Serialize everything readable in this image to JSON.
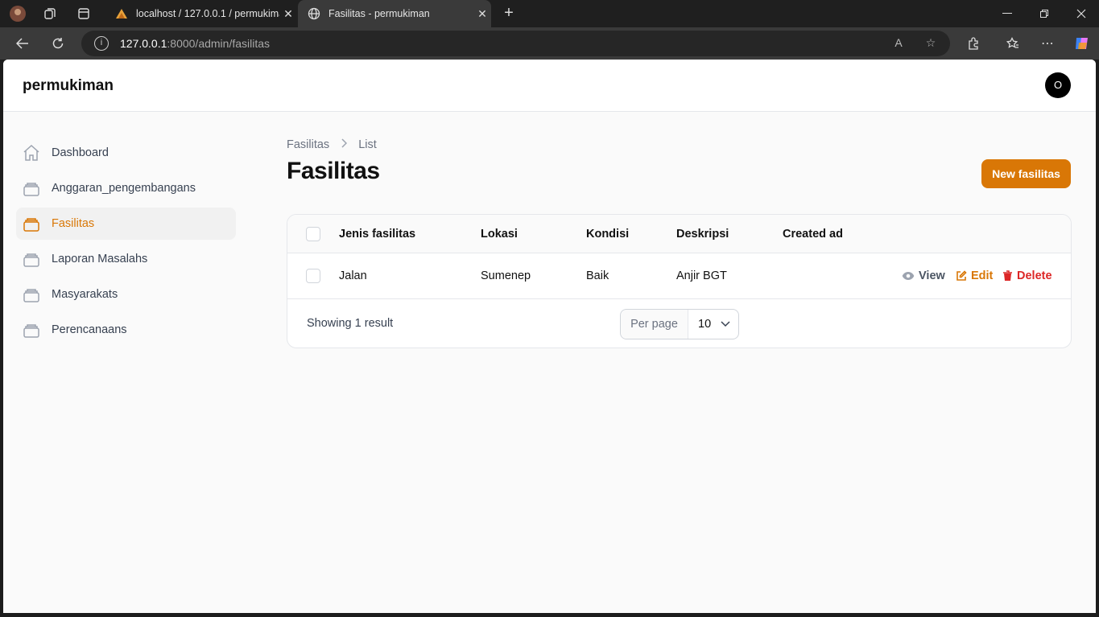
{
  "browser": {
    "tabs": [
      {
        "title": "localhost / 127.0.0.1 / permukiman",
        "active": false
      },
      {
        "title": "Fasilitas - permukiman",
        "active": true
      }
    ],
    "url_host": "127.0.0.1",
    "url_path": ":8000/admin/fasilitas"
  },
  "app": {
    "brand": "permukiman",
    "user_initial": "O",
    "accent_color": "#d97706"
  },
  "sidebar": {
    "items": [
      {
        "label": "Dashboard",
        "icon": "home-icon",
        "active": false
      },
      {
        "label": "Anggaran_pengembangans",
        "icon": "collection-icon",
        "active": false
      },
      {
        "label": "Fasilitas",
        "icon": "collection-icon",
        "active": true
      },
      {
        "label": "Laporan Masalahs",
        "icon": "collection-icon",
        "active": false
      },
      {
        "label": "Masyarakats",
        "icon": "collection-icon",
        "active": false
      },
      {
        "label": "Perencanaans",
        "icon": "collection-icon",
        "active": false
      }
    ]
  },
  "main": {
    "breadcrumb": [
      "Fasilitas",
      "List"
    ],
    "title": "Fasilitas",
    "new_button": "New fasilitas",
    "table": {
      "columns": [
        "Jenis fasilitas",
        "Lokasi",
        "Kondisi",
        "Deskripsi",
        "Created ad"
      ],
      "rows": [
        {
          "cells": [
            "Jalan",
            "Sumenep",
            "Baik",
            "Anjir BGT",
            ""
          ]
        }
      ],
      "actions": {
        "view": "View",
        "edit": "Edit",
        "delete": "Delete"
      }
    },
    "footer": {
      "showing": "Showing 1 result",
      "per_page_label": "Per page",
      "per_page_value": "10"
    }
  }
}
